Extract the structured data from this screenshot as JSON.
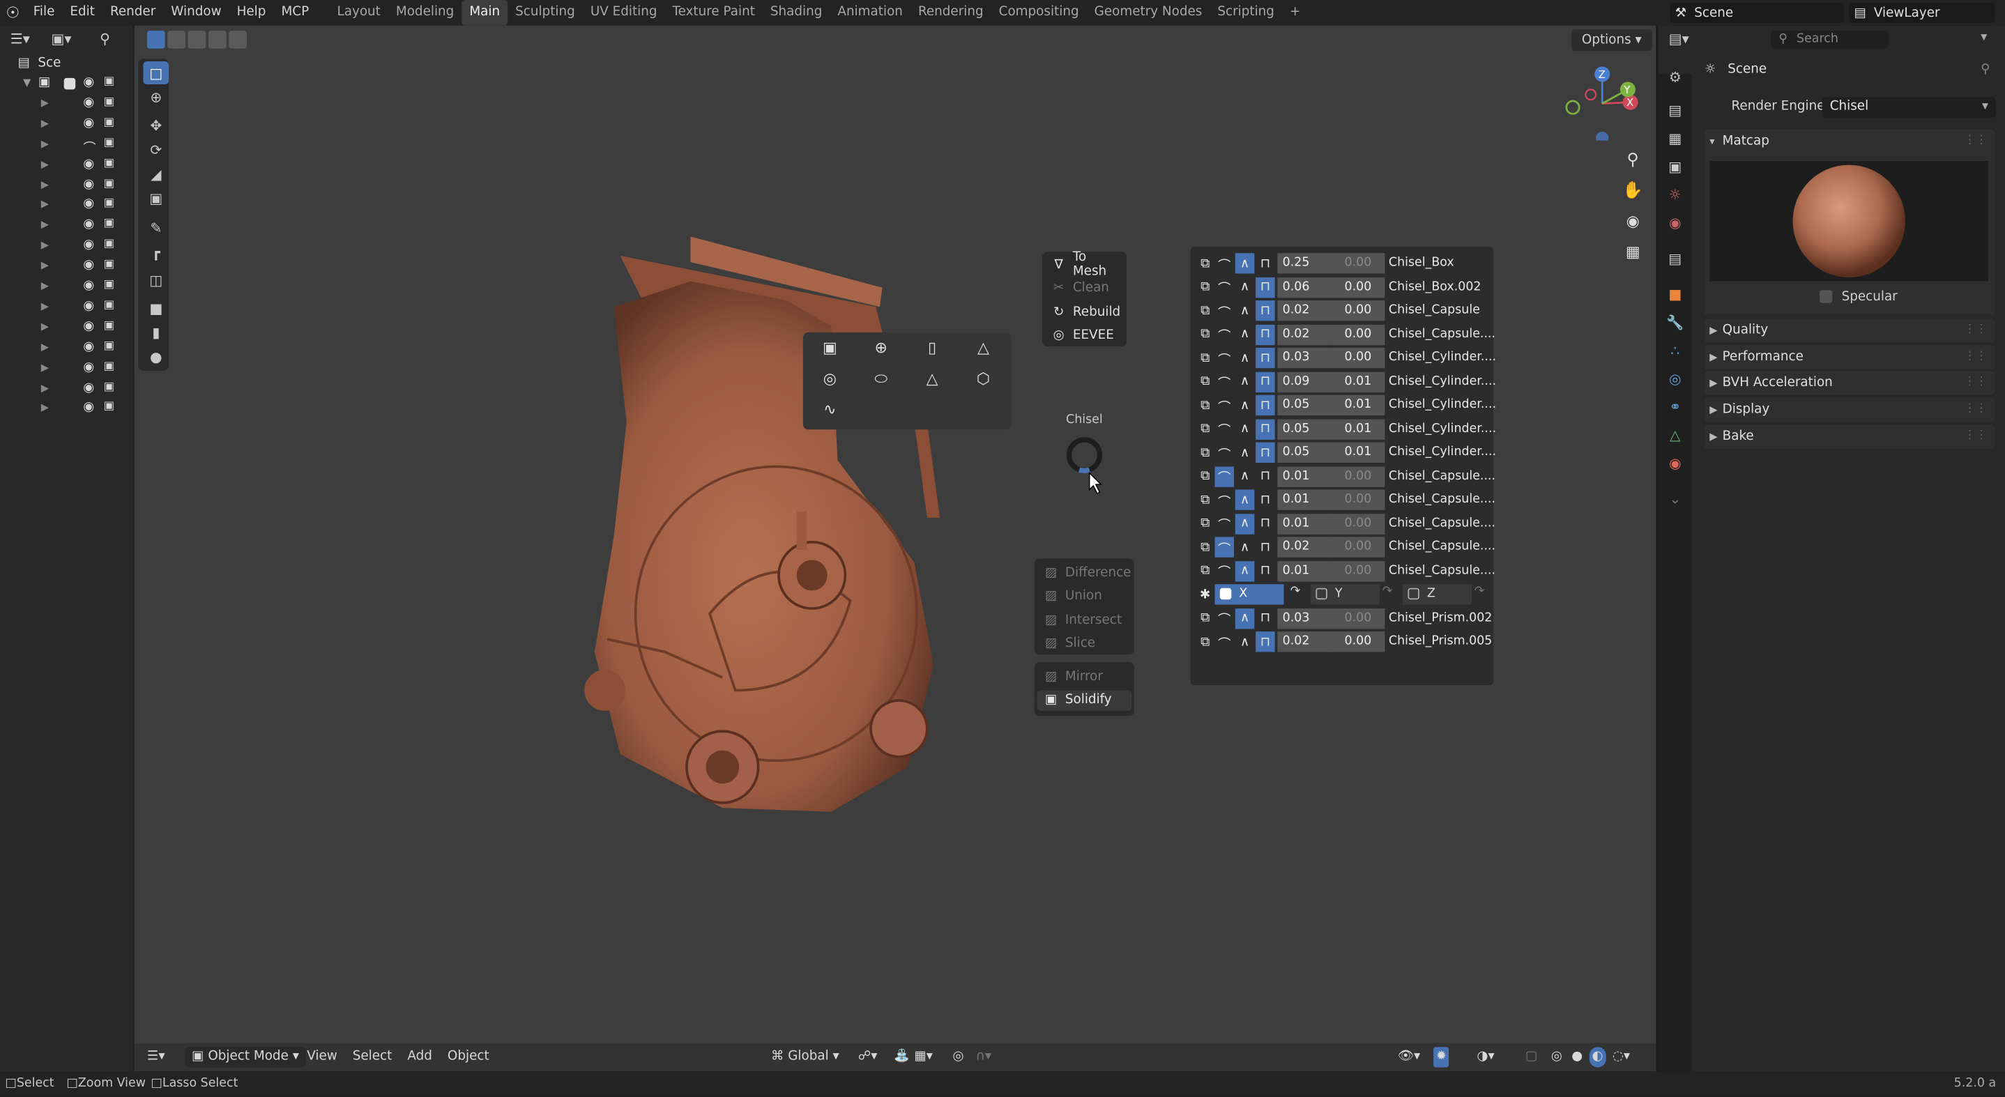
{
  "topbar": {
    "menus": [
      "File",
      "Edit",
      "Render",
      "Window",
      "Help",
      "MCP"
    ],
    "workspaces": [
      "Layout",
      "Modeling",
      "Main",
      "Sculpting",
      "UV Editing",
      "Texture Paint",
      "Shading",
      "Animation",
      "Rendering",
      "Compositing",
      "Geometry Nodes",
      "Scripting"
    ],
    "active_workspace": "Main",
    "add_tab": "+",
    "scene_name": "Scene",
    "view_layer": "ViewLayer"
  },
  "outliner": {
    "root_label": "Sce",
    "row_count": 17
  },
  "viewport": {
    "options_label": "Options",
    "gizmo": {
      "z": "Z",
      "y": "Y",
      "x": "X"
    },
    "pie": {
      "title": "Chisel",
      "top_buttons": [
        {
          "label": "To Mesh",
          "icon": "to-mesh-icon",
          "enabled": true
        },
        {
          "label": "Clean",
          "icon": "clean-icon",
          "enabled": false
        },
        {
          "label": "Rebuild",
          "icon": "rebuild-icon",
          "enabled": true
        },
        {
          "label": "EEVEE",
          "icon": "eevee-icon",
          "enabled": true
        }
      ],
      "bool_buttons": [
        {
          "label": "Difference",
          "enabled": false
        },
        {
          "label": "Union",
          "enabled": false
        },
        {
          "label": "Intersect",
          "enabled": false
        },
        {
          "label": "Slice",
          "enabled": false
        }
      ],
      "mod_buttons": [
        {
          "label": "Mirror",
          "enabled": false
        },
        {
          "label": "Solidify",
          "enabled": true
        }
      ]
    },
    "primitives": [
      "box-icon",
      "sphere-icon",
      "cylinder-icon",
      "cone-icon",
      "torus-icon",
      "capsule-icon",
      "prism-icon",
      "hex-icon",
      "curve-icon"
    ],
    "chisel_list": [
      {
        "blend": 2,
        "v1": "0.25",
        "v2": "0.00",
        "name": "Chisel_Box"
      },
      {
        "blend": 3,
        "v1": "0.06",
        "v2": "0.00",
        "name": "Chisel_Box.002"
      },
      {
        "blend": 3,
        "v1": "0.02",
        "v2": "0.00",
        "name": "Chisel_Capsule"
      },
      {
        "blend": 3,
        "v1": "0.02",
        "v2": "0.00",
        "name": "Chisel_Capsule...."
      },
      {
        "blend": 3,
        "v1": "0.03",
        "v2": "0.00",
        "name": "Chisel_Cylinder...."
      },
      {
        "blend": 3,
        "v1": "0.09",
        "v2": "0.01",
        "name": "Chisel_Cylinder...."
      },
      {
        "blend": 3,
        "v1": "0.05",
        "v2": "0.01",
        "name": "Chisel_Cylinder...."
      },
      {
        "blend": 3,
        "v1": "0.05",
        "v2": "0.01",
        "name": "Chisel_Cylinder...."
      },
      {
        "blend": 3,
        "v1": "0.05",
        "v2": "0.01",
        "name": "Chisel_Cylinder...."
      },
      {
        "blend": 1,
        "v1": "0.01",
        "v2": "0.00",
        "name": "Chisel_Capsule...."
      },
      {
        "blend": 2,
        "v1": "0.01",
        "v2": "0.00",
        "name": "Chisel_Capsule...."
      },
      {
        "blend": 2,
        "v1": "0.01",
        "v2": "0.00",
        "name": "Chisel_Capsule...."
      },
      {
        "blend": 1,
        "v1": "0.02",
        "v2": "0.00",
        "name": "Chisel_Capsule...."
      },
      {
        "blend": 2,
        "v1": "0.01",
        "v2": "0.00",
        "name": "Chisel_Capsule...."
      }
    ],
    "mirror_row": {
      "x": "X",
      "y": "Y",
      "z": "Z"
    },
    "chisel_list_tail": [
      {
        "blend": 2,
        "v1": "0.03",
        "v2": "0.00",
        "name": "Chisel_Prism.002"
      },
      {
        "blend": 3,
        "v1": "0.02",
        "v2": "0.00",
        "name": "Chisel_Prism.005"
      }
    ],
    "header": {
      "mode": "Object Mode",
      "menus": [
        "View",
        "Select",
        "Add",
        "Object"
      ],
      "orientation": "Global"
    }
  },
  "properties": {
    "search_placeholder": "Search",
    "scene_label": "Scene",
    "render_engine_label": "Render Engine",
    "render_engine_value": "Chisel",
    "matcap_label": "Matcap",
    "specular_label": "Specular",
    "panels": [
      "Quality",
      "Performance",
      "BVH Acceleration",
      "Display",
      "Bake"
    ]
  },
  "statusbar": {
    "items": [
      "Select",
      "Zoom View",
      "Lasso Select"
    ],
    "version": "5.2.0 a"
  },
  "colors": {
    "accent": "#4772b3",
    "model": "#a3634a"
  }
}
